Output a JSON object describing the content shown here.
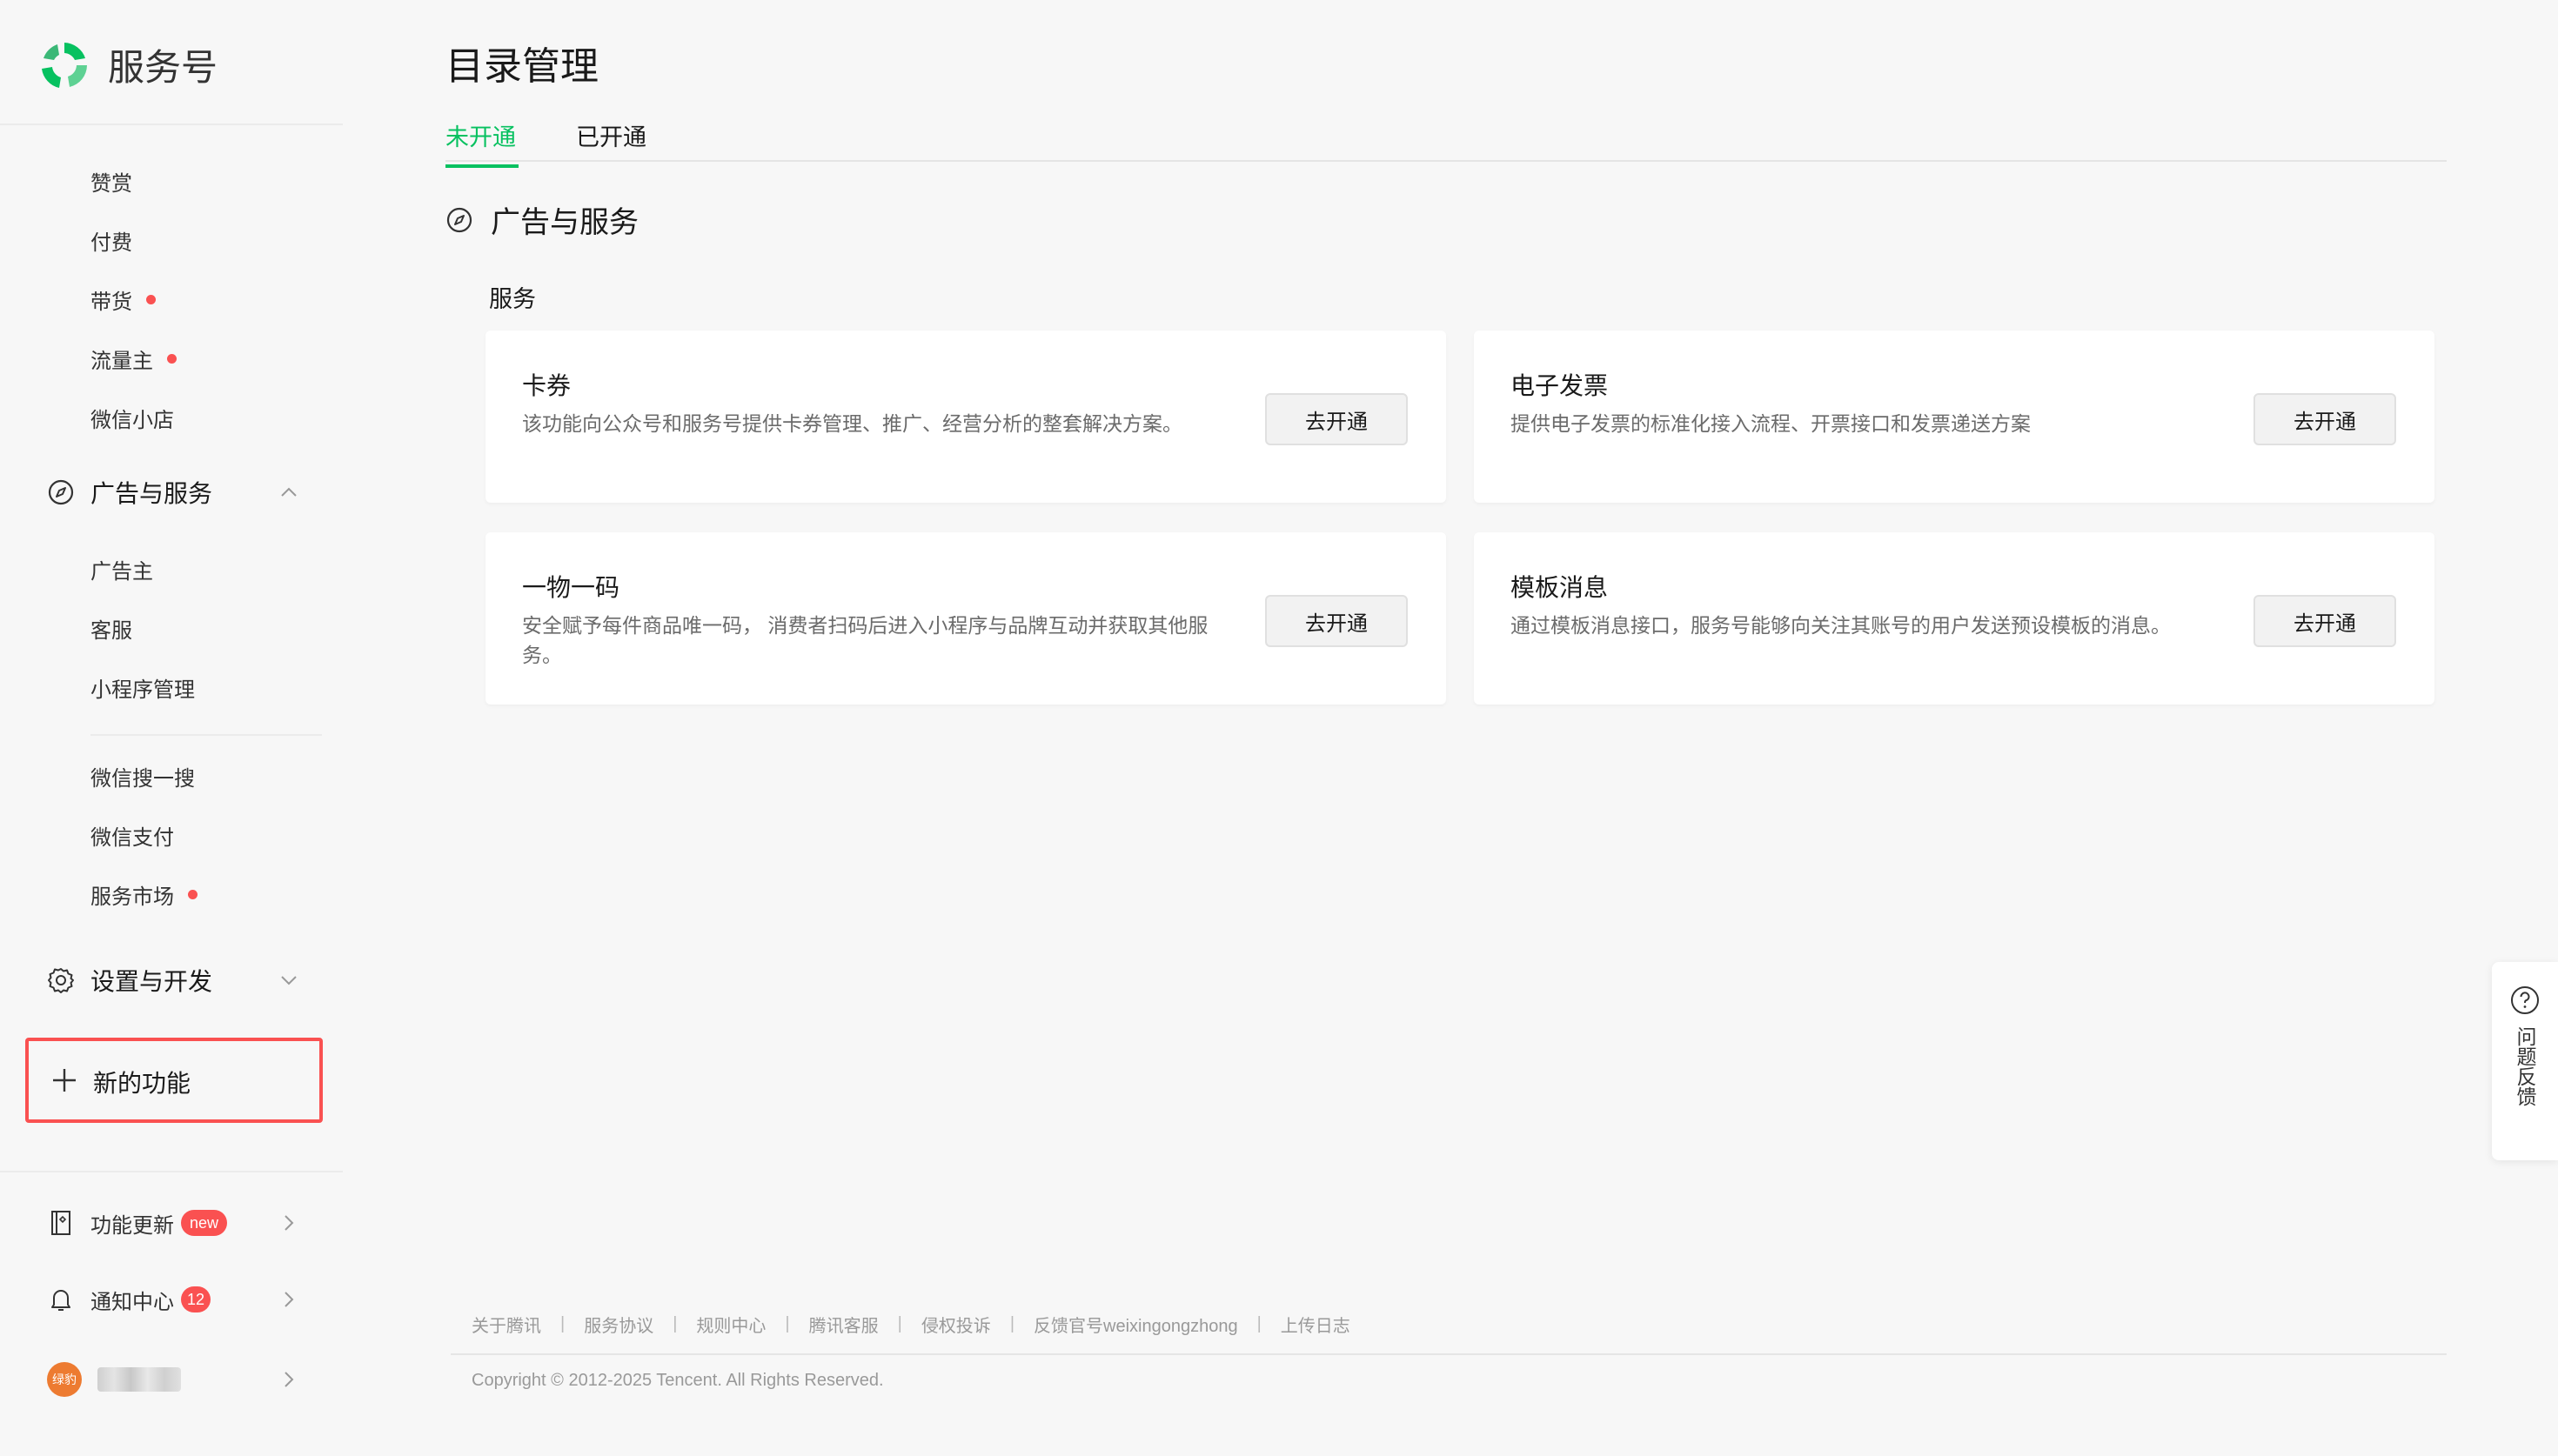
{
  "app": {
    "name": "服务号",
    "brand_color": "#07c160",
    "alert_color": "#fa5151"
  },
  "sidebar": {
    "top_items": [
      {
        "label": "赞赏",
        "dot": false
      },
      {
        "label": "付费",
        "dot": false
      },
      {
        "label": "带货",
        "dot": true
      },
      {
        "label": "流量主",
        "dot": true
      },
      {
        "label": "微信小店",
        "dot": false
      }
    ],
    "group_ads": {
      "label": "广告与服务",
      "icon": "compass-icon",
      "expanded": true,
      "items": [
        "广告主",
        "客服",
        "小程序管理"
      ],
      "items2": [
        {
          "label": "微信搜一搜",
          "dot": false
        },
        {
          "label": "微信支付",
          "dot": false
        },
        {
          "label": "服务市场",
          "dot": true
        }
      ]
    },
    "group_settings": {
      "label": "设置与开发",
      "icon": "gear-icon",
      "expanded": false
    },
    "new_feature": {
      "label": "新的功能",
      "icon": "plus-icon"
    },
    "bottom": {
      "updates": {
        "label": "功能更新",
        "badge": "new",
        "icon": "book-icon"
      },
      "notifications": {
        "label": "通知中心",
        "badge": "12",
        "icon": "bell-icon"
      },
      "account": {
        "avatar_text": "绿豹",
        "icon": "avatar"
      }
    }
  },
  "main": {
    "title": "目录管理",
    "tabs": [
      {
        "label": "未开通",
        "active": true
      },
      {
        "label": "已开通",
        "active": false
      }
    ],
    "section": {
      "title": "广告与服务",
      "icon": "compass-icon"
    },
    "subsection": "服务",
    "cards": [
      {
        "title": "卡券",
        "desc": "该功能向公众号和服务号提供卡券管理、推广、经营分析的整套解决方案。",
        "button": "去开通"
      },
      {
        "title": "电子发票",
        "desc": "提供电子发票的标准化接入流程、开票接口和发票递送方案",
        "button": "去开通"
      },
      {
        "title": "一物一码",
        "desc": "安全赋予每件商品唯一码， 消费者扫码后进入小程序与品牌互动并获取其他服务。",
        "button": "去开通"
      },
      {
        "title": "模板消息",
        "desc": "通过模板消息接口，服务号能够向关注其账号的用户发送预设模板的消息。",
        "button": "去开通"
      }
    ]
  },
  "footer": {
    "links": [
      "关于腾讯",
      "服务协议",
      "规则中心",
      "腾讯客服",
      "侵权投诉",
      "反馈官号weixingongzhong",
      "上传日志"
    ],
    "separator": "|",
    "copyright": "Copyright © 2012-2025 Tencent. All Rights Reserved."
  },
  "feedback": {
    "label": "问题反馈",
    "icon": "question-circle-icon"
  }
}
